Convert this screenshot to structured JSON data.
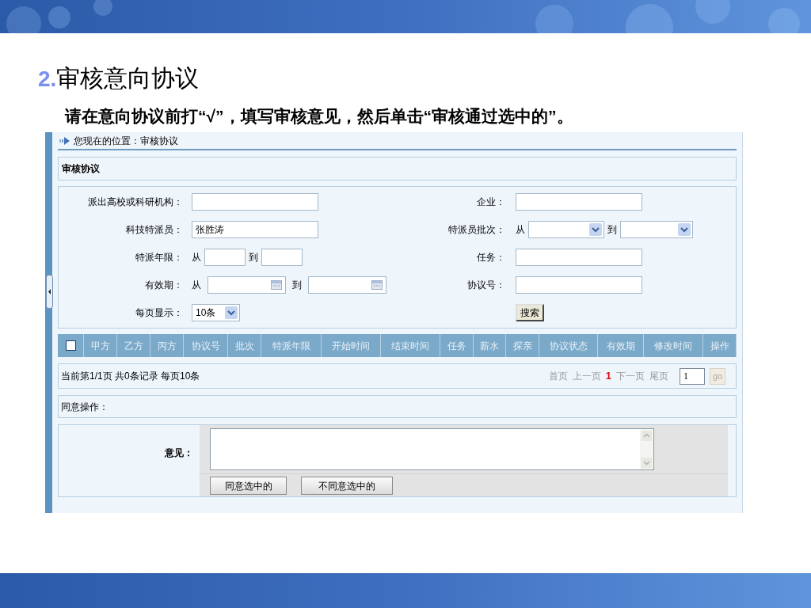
{
  "slide": {
    "number": "2.",
    "title": "审核意向协议",
    "instruction": "请在意向协议前打“√”，填写审核意见，然后单击“审核通过选中的”。"
  },
  "app": {
    "breadcrumb": "您现在的位置：审核协议",
    "section_title": "审核协议",
    "form": [
      {
        "left": {
          "label": "派出高校或科研机构：",
          "kind": "text"
        },
        "right": {
          "label": "企业：",
          "kind": "text"
        }
      },
      {
        "left": {
          "label": "科技特派员：",
          "kind": "text",
          "value": "张胜涛"
        },
        "right": {
          "label": "特派员批次：",
          "kind": "select_range",
          "from": "从",
          "to": "到"
        }
      },
      {
        "left": {
          "label": "特派年限：",
          "kind": "range",
          "from": "从",
          "to": "到"
        },
        "right": {
          "label": "任务：",
          "kind": "text"
        }
      },
      {
        "left": {
          "label": "有效期：",
          "kind": "date_range",
          "from": "从",
          "to": "到"
        },
        "right": {
          "label": "协议号：",
          "kind": "text"
        }
      },
      {
        "left": {
          "label": "每页显示：",
          "kind": "select",
          "value": "10条"
        },
        "right": {
          "kind": "button",
          "label": "搜索"
        }
      }
    ],
    "table": {
      "select_all": {
        "checked": false
      },
      "columns": [
        "甲方",
        "乙方",
        "丙方",
        "协议号",
        "批次",
        "特派年限",
        "开始时间",
        "结束时间",
        "任务",
        "薪水",
        "探亲",
        "协议状态",
        "有效期",
        "修改时间",
        "操作"
      ]
    },
    "pager": {
      "info": "当前第1/1页 共0条记录 每页10条",
      "links": [
        {
          "label": "首页",
          "selected": false
        },
        {
          "label": "上一页",
          "selected": false
        },
        {
          "label": "1",
          "selected": true
        },
        {
          "label": "下一页",
          "selected": false
        },
        {
          "label": "尾页",
          "selected": false
        }
      ],
      "page_input": "1",
      "go": "go"
    },
    "approval": {
      "title": "同意操作：",
      "opinion_label": "意见：",
      "buttons": [
        "同意选中的",
        "不同意选中的"
      ]
    }
  }
}
